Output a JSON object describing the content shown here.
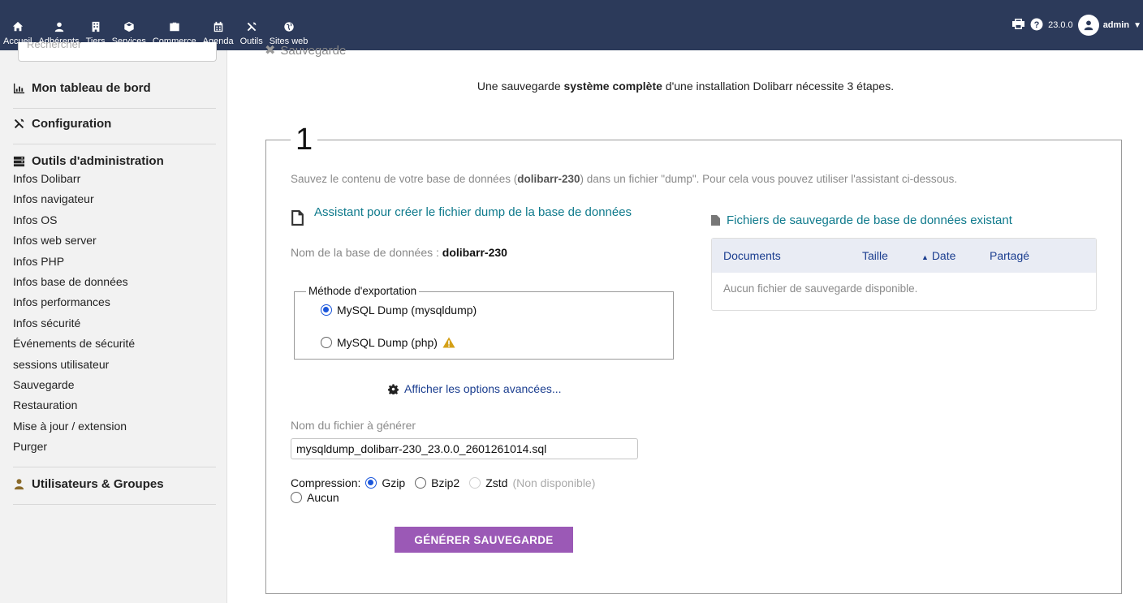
{
  "topmenu": [
    {
      "label": "Accueil",
      "icon": "home-icon"
    },
    {
      "label": "Adhérents",
      "icon": "member-icon"
    },
    {
      "label": "Tiers",
      "icon": "building-icon"
    },
    {
      "label": "Services",
      "icon": "cube-icon"
    },
    {
      "label": "Commerce",
      "icon": "briefcase-icon"
    },
    {
      "label": "Agenda",
      "icon": "calendar-icon"
    },
    {
      "label": "Outils",
      "icon": "tools-icon"
    },
    {
      "label": "Sites web",
      "icon": "globe-icon"
    }
  ],
  "topright": {
    "version": "23.0.0",
    "user": "admin"
  },
  "sidebar": {
    "search_placeholder": "Rechercher",
    "dashboard": "Mon tableau de bord",
    "configuration": "Configuration",
    "admin_tools": "Outils d'administration",
    "admin_items": [
      "Infos Dolibarr",
      "Infos navigateur",
      "Infos OS",
      "Infos web server",
      "Infos PHP",
      "Infos base de données",
      "Infos performances",
      "Infos sécurité",
      "Événements de sécurité",
      "sessions utilisateur",
      "Sauvegarde",
      "Restauration",
      "Mise à jour / extension",
      "Purger"
    ],
    "users_groups": "Utilisateurs & Groupes"
  },
  "main": {
    "page_title": "Sauvegarde",
    "intro_pre": "Une sauvegarde ",
    "intro_bold": "système complète",
    "intro_post": " d'une installation Dolibarr nécessite 3 étapes.",
    "step_number": "1",
    "step_desc_pre": "Sauvez le contenu de votre base de données (",
    "step_desc_db": "dolibarr-230",
    "step_desc_post": ") dans un fichier \"dump\". Pour cela vous pouvez utiliser l'assistant ci-dessous.",
    "assistant_title": "Assistant pour créer le fichier dump de la base de données",
    "db_name_label": "Nom de la base de données : ",
    "db_name_value": "dolibarr-230",
    "export_method_legend": "Méthode d'exportation",
    "export_options": [
      "MySQL Dump (mysqldump)",
      "MySQL Dump (php)"
    ],
    "export_selected": 0,
    "advanced_options": "Afficher les options avancées...",
    "filename_label": "Nom du fichier à générer",
    "filename_value": "mysqldump_dolibarr-230_23.0.0_2601261014.sql",
    "compression_label": "Compression:",
    "compression_options": [
      "Gzip",
      "Bzip2",
      "Zstd",
      "Aucun"
    ],
    "compression_unavailable": "(Non disponible)",
    "compression_selected": "Gzip",
    "generate_button": "GÉNÉRER SAUVEGARDE",
    "files_title": "Fichiers de sauvegarde de base de données existant",
    "files_columns": [
      "Documents",
      "Taille",
      "Date",
      "Partagé"
    ],
    "files_empty": "Aucun fichier de sauvegarde disponible."
  },
  "colors": {
    "topbar": "#2c3a5a",
    "link": "#0f7a8c",
    "button": "#9b59b6",
    "radio": "#1a56db"
  }
}
